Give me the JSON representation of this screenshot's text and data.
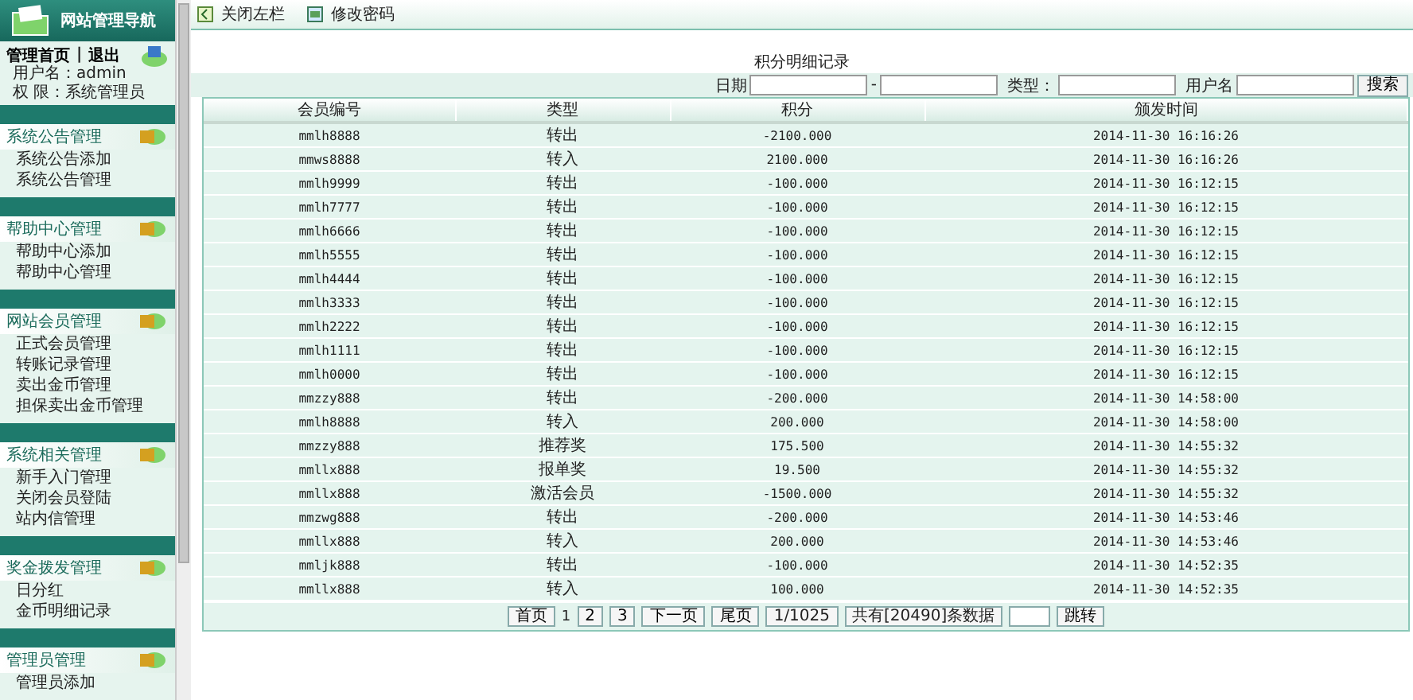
{
  "sidebar": {
    "title": "网站管理导航",
    "home_link": "管理首页",
    "separator": "|",
    "logout_link": "退出",
    "user_line": "用户名：admin",
    "role_line": "权 限：系统管理员",
    "groups": [
      {
        "title": "系统公告管理",
        "items": [
          "系统公告添加",
          "系统公告管理"
        ]
      },
      {
        "title": "帮助中心管理",
        "items": [
          "帮助中心添加",
          "帮助中心管理"
        ]
      },
      {
        "title": "网站会员管理",
        "items": [
          "正式会员管理",
          "转账记录管理",
          "卖出金币管理",
          "担保卖出金币管理"
        ]
      },
      {
        "title": "系统相关管理",
        "items": [
          "新手入门管理",
          "关闭会员登陆",
          "站内信管理"
        ]
      },
      {
        "title": "奖金拨发管理",
        "items": [
          "日分红",
          "金币明细记录"
        ]
      },
      {
        "title": "管理员管理",
        "items": [
          "管理员添加"
        ]
      }
    ]
  },
  "toolbar": [
    {
      "kind": "collapse",
      "label": "关闭左栏"
    },
    {
      "kind": "password",
      "label": "修改密码"
    }
  ],
  "page_title": "积分明细记录",
  "filter": {
    "date_label": "日期",
    "date_separator": "-",
    "type_label": "类型：",
    "user_label": "用户名",
    "search_button": "搜索"
  },
  "table": {
    "columns": [
      "会员编号",
      "类型",
      "积分",
      "颁发时间"
    ],
    "rows": [
      [
        "mmlh8888",
        "转出",
        "-2100.000",
        "2014-11-30 16:16:26"
      ],
      [
        "mmws8888",
        "转入",
        "2100.000",
        "2014-11-30 16:16:26"
      ],
      [
        "mmlh9999",
        "转出",
        "-100.000",
        "2014-11-30 16:12:15"
      ],
      [
        "mmlh7777",
        "转出",
        "-100.000",
        "2014-11-30 16:12:15"
      ],
      [
        "mmlh6666",
        "转出",
        "-100.000",
        "2014-11-30 16:12:15"
      ],
      [
        "mmlh5555",
        "转出",
        "-100.000",
        "2014-11-30 16:12:15"
      ],
      [
        "mmlh4444",
        "转出",
        "-100.000",
        "2014-11-30 16:12:15"
      ],
      [
        "mmlh3333",
        "转出",
        "-100.000",
        "2014-11-30 16:12:15"
      ],
      [
        "mmlh2222",
        "转出",
        "-100.000",
        "2014-11-30 16:12:15"
      ],
      [
        "mmlh1111",
        "转出",
        "-100.000",
        "2014-11-30 16:12:15"
      ],
      [
        "mmlh0000",
        "转出",
        "-100.000",
        "2014-11-30 16:12:15"
      ],
      [
        "mmzzy888",
        "转出",
        "-200.000",
        "2014-11-30 14:58:00"
      ],
      [
        "mmlh8888",
        "转入",
        "200.000",
        "2014-11-30 14:58:00"
      ],
      [
        "mmzzy888",
        "推荐奖",
        "175.500",
        "2014-11-30 14:55:32"
      ],
      [
        "mmllx888",
        "报单奖",
        "19.500",
        "2014-11-30 14:55:32"
      ],
      [
        "mmllx888",
        "激活会员",
        "-1500.000",
        "2014-11-30 14:55:32"
      ],
      [
        "mmzwg888",
        "转出",
        "-200.000",
        "2014-11-30 14:53:46"
      ],
      [
        "mmllx888",
        "转入",
        "200.000",
        "2014-11-30 14:53:46"
      ],
      [
        "mmljk888",
        "转出",
        "-100.000",
        "2014-11-30 14:52:35"
      ],
      [
        "mmllx888",
        "转入",
        "100.000",
        "2014-11-30 14:52:35"
      ]
    ]
  },
  "pagination": {
    "first": "首页",
    "pages": [
      {
        "label": "1",
        "selected": true
      },
      {
        "label": "2",
        "selected": false
      },
      {
        "label": "3",
        "selected": false
      }
    ],
    "next": "下一页",
    "last": "尾页",
    "page_info": "1/1025",
    "total": "共有[20490]条数据",
    "jump_button": "跳转"
  }
}
